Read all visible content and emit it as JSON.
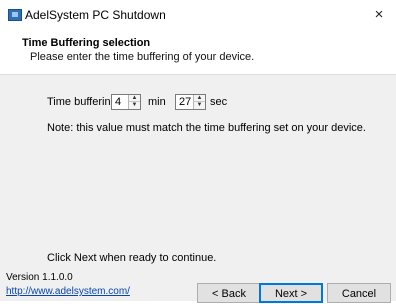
{
  "window": {
    "title": "AdelSystem PC Shutdown",
    "close_glyph": "×"
  },
  "header": {
    "title": "Time Buffering selection",
    "subtitle": "Please enter the time buffering of your device."
  },
  "form": {
    "time_buffering_label": "Time buffering:",
    "minutes_value": "4",
    "minutes_unit": "min",
    "seconds_value": "27",
    "seconds_unit": "sec",
    "note": "Note: this value must match the time buffering set on your device."
  },
  "hint": "Click Next when ready to continue.",
  "footer": {
    "version": "Version 1.1.0.0",
    "link": "http://www.adelsystem.com/",
    "back_label": "< Back",
    "next_label": "Next >",
    "cancel_label": "Cancel"
  },
  "icons": {
    "app": "monitor-icon",
    "spin_up": "▲",
    "spin_down": "▼"
  }
}
